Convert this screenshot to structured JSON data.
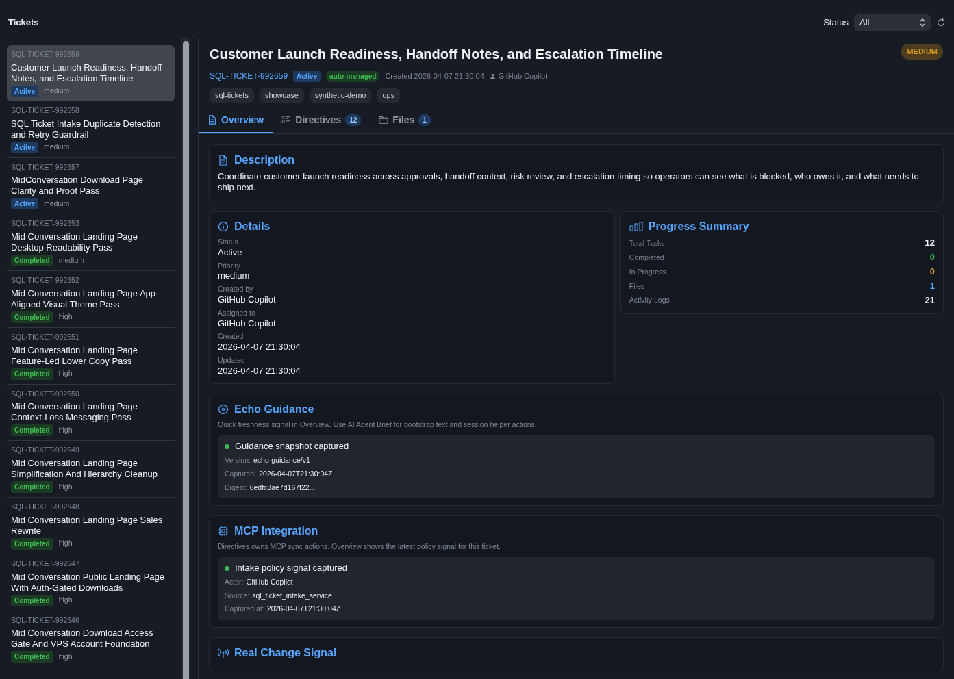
{
  "header": {
    "title": "Tickets",
    "status_label": "Status",
    "status_value": "All"
  },
  "tickets": [
    {
      "id": "SQL-TICKET-992659",
      "title": "Customer Launch Readiness, Handoff Notes, and Escalation Timeline",
      "status": "Active",
      "kind": "active",
      "priority": "medium",
      "selected": true
    },
    {
      "id": "SQL-TICKET-992658",
      "title": "SQL Ticket Intake Duplicate Detection and Retry Guardrail",
      "status": "Active",
      "kind": "active",
      "priority": "medium",
      "selected": false
    },
    {
      "id": "SQL-TICKET-992657",
      "title": "MidConversation Download Page Clarity and Proof Pass",
      "status": "Active",
      "kind": "active",
      "priority": "medium",
      "selected": false
    },
    {
      "id": "SQL-TICKET-992653",
      "title": "Mid Conversation Landing Page Desktop Readability Pass",
      "status": "Completed",
      "kind": "completed",
      "priority": "medium",
      "selected": false
    },
    {
      "id": "SQL-TICKET-992652",
      "title": "Mid Conversation Landing Page App-Aligned Visual Theme Pass",
      "status": "Completed",
      "kind": "completed",
      "priority": "high",
      "selected": false
    },
    {
      "id": "SQL-TICKET-992651",
      "title": "Mid Conversation Landing Page Feature-Led Lower Copy Pass",
      "status": "Completed",
      "kind": "completed",
      "priority": "high",
      "selected": false
    },
    {
      "id": "SQL-TICKET-992650",
      "title": "Mid Conversation Landing Page Context-Loss Messaging Pass",
      "status": "Completed",
      "kind": "completed",
      "priority": "high",
      "selected": false
    },
    {
      "id": "SQL-TICKET-992649",
      "title": "Mid Conversation Landing Page Simplification And Hierarchy Cleanup",
      "status": "Completed",
      "kind": "completed",
      "priority": "high",
      "selected": false
    },
    {
      "id": "SQL-TICKET-992648",
      "title": "Mid Conversation Landing Page Sales Rewrite",
      "status": "Completed",
      "kind": "completed",
      "priority": "high",
      "selected": false
    },
    {
      "id": "SQL-TICKET-992647",
      "title": "Mid Conversation Public Landing Page With Auth-Gated Downloads",
      "status": "Completed",
      "kind": "completed",
      "priority": "high",
      "selected": false
    },
    {
      "id": "SQL-TICKET-992646",
      "title": "Mid Conversation Download Access Gate And VPS Account Foundation",
      "status": "Completed",
      "kind": "completed",
      "priority": "high",
      "selected": false
    }
  ],
  "detail": {
    "title": "Customer Launch Readiness, Handoff Notes, and Escalation Timeline",
    "priority_badge": "MEDIUM",
    "id": "SQL-TICKET-992659",
    "status": "Active",
    "managed": "auto-managed",
    "created": "Created 2026-04-07 21:30:04",
    "author": "GitHub Copilot",
    "tags": [
      "sql-tickets",
      "showcase",
      "synthetic-demo",
      "ops"
    ],
    "tabs": [
      {
        "label": "Overview",
        "selected": true,
        "kind": "doc"
      },
      {
        "label": "Directives",
        "count": "12",
        "selected": false,
        "kind": "list"
      },
      {
        "label": "Files",
        "count": "1",
        "selected": false,
        "kind": "folder"
      }
    ],
    "description": {
      "title": "Description",
      "text": "Coordinate customer launch readiness across approvals, handoff context, risk review, and escalation timing so operators can see what is blocked, who owns it, and what needs to ship next."
    },
    "details": {
      "title": "Details",
      "fields": [
        {
          "label": "Status",
          "value": "Active"
        },
        {
          "label": "Priority",
          "value": "medium"
        },
        {
          "label": "Created by",
          "value": "GitHub Copilot"
        },
        {
          "label": "Assigned to",
          "value": "GitHub Copilot"
        },
        {
          "label": "Created",
          "value": "2026-04-07 21:30:04"
        },
        {
          "label": "Updated",
          "value": "2026-04-07 21:30:04"
        }
      ]
    },
    "progress": {
      "title": "Progress Summary",
      "stats": [
        {
          "label": "Total Tasks",
          "value": "12",
          "color": "#f0f3f6"
        },
        {
          "label": "Completed",
          "value": "0",
          "color": "#3fb950"
        },
        {
          "label": "In Progress",
          "value": "0",
          "color": "#d29922"
        },
        {
          "label": "Files",
          "value": "1",
          "color": "#58a6ff"
        },
        {
          "label": "Activity Logs",
          "value": "21",
          "color": "#f0f3f6"
        }
      ]
    },
    "signals": [
      {
        "title": "Echo Guidance",
        "kind": "echo",
        "note": "Quick freshness signal in Overview. Use AI Agent Brief for bootstrap text and session helper actions.",
        "headline": "Guidance snapshot captured",
        "rows": [
          {
            "label": "Version:",
            "value": "echo-guidance/v1"
          },
          {
            "label": "Captured:",
            "value": "2026-04-07T21:30:04Z"
          },
          {
            "label": "Digest:",
            "value": "6edfc8ae7d167f22..."
          }
        ]
      },
      {
        "title": "MCP Integration",
        "kind": "chip",
        "note": "Directives owns MCP sync actions. Overview shows the latest policy signal for this ticket.",
        "headline": "Intake policy signal captured",
        "rows": [
          {
            "label": "Actor:",
            "value": "GitHub Copilot"
          },
          {
            "label": "Source:",
            "value": "sql_ticket_intake_service"
          },
          {
            "label": "Captured at:",
            "value": "2026-04-07T21:30:04Z"
          }
        ]
      },
      {
        "title": "Real Change Signal",
        "kind": "antenna"
      }
    ]
  }
}
